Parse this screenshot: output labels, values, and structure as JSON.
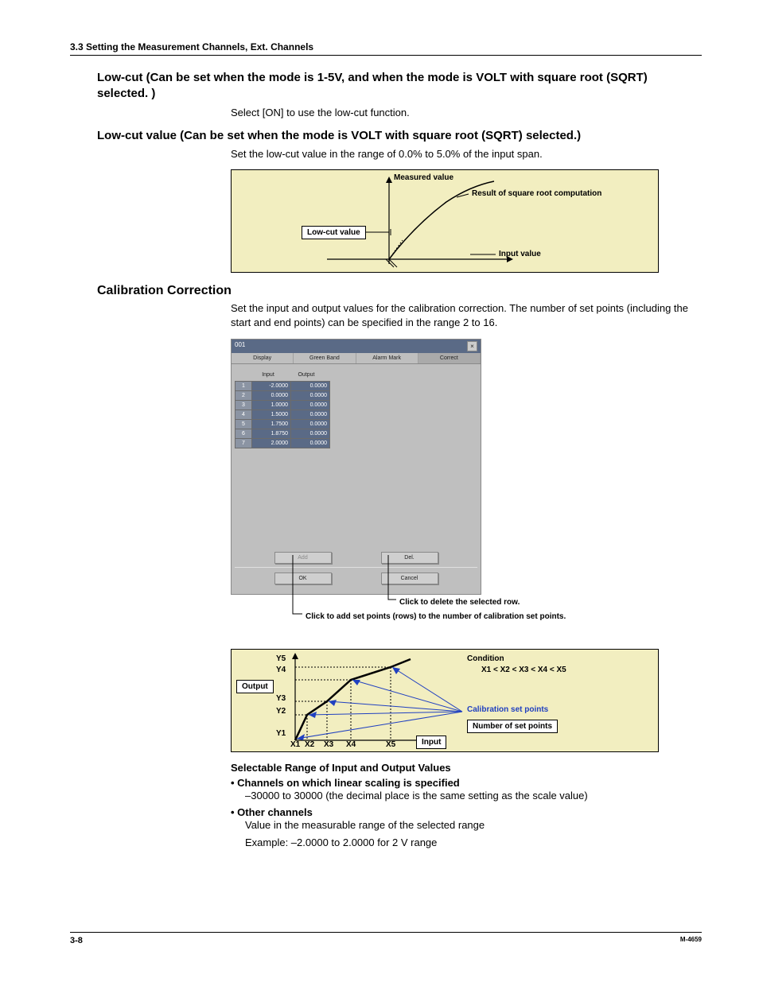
{
  "header": "3.3  Setting the Measurement Channels, Ext. Channels",
  "lowcut": {
    "heading": "Low-cut (Can be set when the mode is 1-5V, and when the mode is VOLT with square root (SQRT) selected. )",
    "body": "Select [ON] to use the low-cut function."
  },
  "lowcut_value": {
    "heading": "Low-cut value (Can be set when the mode is VOLT with square root (SQRT) selected.)",
    "body": "Set the low-cut value in the range of 0.0% to 5.0% of the input span."
  },
  "diag1": {
    "measured": "Measured value",
    "result": "Result of square root computation",
    "lowcut": "Low-cut value",
    "input": "Input value"
  },
  "calib": {
    "heading": "Calibration Correction",
    "body": "Set the input and output values for the calibration correction. The number of set points (including the start and end points) can be specified in the range 2 to 16."
  },
  "dialog": {
    "title": "001",
    "close": "×",
    "tabs": [
      "Display",
      "Green Band",
      "Alarm Mark",
      "Correct"
    ],
    "col_input": "Input",
    "col_output": "Output",
    "rows": [
      {
        "i": "1",
        "in": "-2.0000",
        "out": "0.0000"
      },
      {
        "i": "2",
        "in": "0.0000",
        "out": "0.0000"
      },
      {
        "i": "3",
        "in": "1.0000",
        "out": "0.0000"
      },
      {
        "i": "4",
        "in": "1.5000",
        "out": "0.0000"
      },
      {
        "i": "5",
        "in": "1.7500",
        "out": "0.0000"
      },
      {
        "i": "6",
        "in": "1.8750",
        "out": "0.0000"
      },
      {
        "i": "7",
        "in": "2.0000",
        "out": "0.0000"
      }
    ],
    "btn_add": "Add",
    "btn_del": "Del.",
    "btn_ok": "OK",
    "btn_cancel": "Cancel"
  },
  "callouts": {
    "del": "Click to delete the selected row.",
    "add": "Click to add set points (rows) to the number of calibration set points."
  },
  "diag2": {
    "output": "Output",
    "input": "Input",
    "y": [
      "Y1",
      "Y2",
      "Y3",
      "Y4",
      "Y5"
    ],
    "x": [
      "X1",
      "X2",
      "X3",
      "X4",
      "X5"
    ],
    "condition": "Condition",
    "condition_expr": "X1 < X2 < X3 < X4 < X5",
    "calib_pts": "Calibration set points",
    "num_pts": "Number of set points"
  },
  "range": {
    "heading": "Selectable Range of Input and Output Values",
    "b1_h": "•  Channels on which linear scaling is specified",
    "b1_t": "–30000 to 30000 (the decimal place is the same setting as the scale value)",
    "b2_h": "•  Other channels",
    "b2_t1": "Value in the measurable range of the selected range",
    "b2_t2": "Example:   –2.0000 to 2.0000 for 2 V range"
  },
  "footer": {
    "page": "3-8",
    "doc": "M-4659"
  }
}
